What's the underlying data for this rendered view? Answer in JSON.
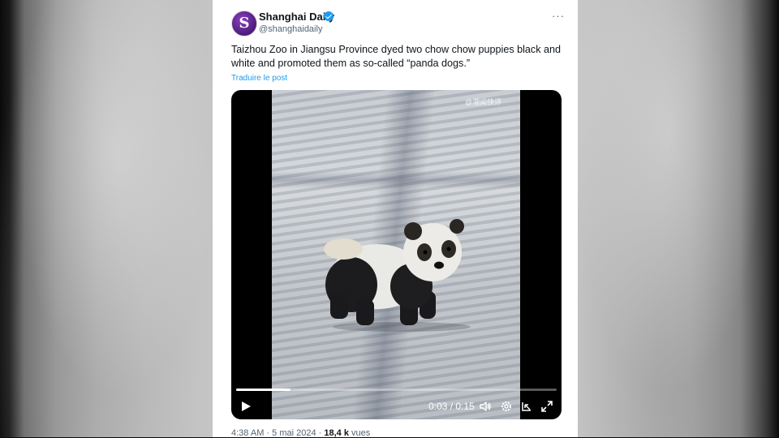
{
  "tweet": {
    "author_name": "Shanghai Daily",
    "handle": "@shanghaidaily",
    "avatar_letter": "S",
    "more_label": "···",
    "text": "Taizhou Zoo in Jiangsu Province dyed two chow chow puppies black and white and promoted them as so-called “panda dogs.”",
    "translate_label": "Traduire le post"
  },
  "video": {
    "watermark": "@潮闻快评",
    "progress": 0.17,
    "time": "0:03 / 0:15"
  },
  "footer": {
    "time": "4:38 AM",
    "sep1": " · ",
    "date": "5 mai 2024",
    "sep2": " · ",
    "views_count": "18,4 k",
    "views_label": " vues"
  },
  "colors": {
    "accent": "#1d9bf0",
    "text": "#0f1419",
    "muted": "#536471"
  }
}
